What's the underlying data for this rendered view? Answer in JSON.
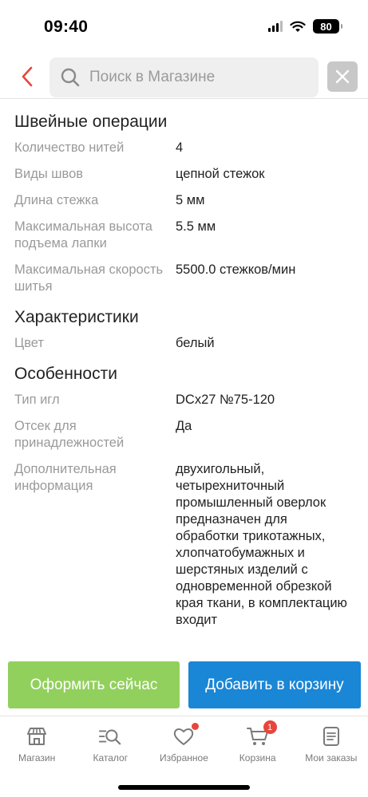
{
  "status_bar": {
    "time": "09:40",
    "battery": "80"
  },
  "search": {
    "placeholder": "Поиск в Магазине",
    "value": ""
  },
  "sections": [
    {
      "title": "Швейные операции",
      "rows": [
        {
          "label": "Количество нитей",
          "value": "4"
        },
        {
          "label": "Виды швов",
          "value": "цепной стежок"
        },
        {
          "label": "Длина стежка",
          "value": "5 мм"
        },
        {
          "label": "Максимальная высота подъема лапки",
          "value": "5.5 мм"
        },
        {
          "label": "Максимальная скорость шитья",
          "value": "5500.0 стежков/мин"
        }
      ]
    },
    {
      "title": "Характеристики",
      "rows": [
        {
          "label": "Цвет",
          "value": "белый"
        }
      ]
    },
    {
      "title": "Особенности",
      "rows": [
        {
          "label": "Тип игл",
          "value": "DCx27 №75-120"
        },
        {
          "label": "Отсек для принадлежностей",
          "value": "Да"
        },
        {
          "label": "Дополнительная информация",
          "value": "двухигольный, четырехниточный промышленный оверлок предназначен для обработки трикотажных, хлопчатобумажных и шерстяных изделий с одновременной обрезкой края ткани, в комплектацию входит"
        }
      ]
    }
  ],
  "actions": {
    "checkout": "Оформить сейчас",
    "add_to_cart": "Добавить в корзину"
  },
  "nav": {
    "items": [
      {
        "label": "Магазин",
        "icon": "store-icon"
      },
      {
        "label": "Каталог",
        "icon": "catalog-search-icon"
      },
      {
        "label": "Избранное",
        "icon": "heart-icon"
      },
      {
        "label": "Корзина",
        "icon": "cart-icon"
      },
      {
        "label": "Мои заказы",
        "icon": "orders-icon"
      }
    ],
    "cart_count": "1"
  },
  "colors": {
    "accent_red": "#e8453c",
    "checkout_green": "#92d05d",
    "cart_blue": "#1a86d6"
  }
}
